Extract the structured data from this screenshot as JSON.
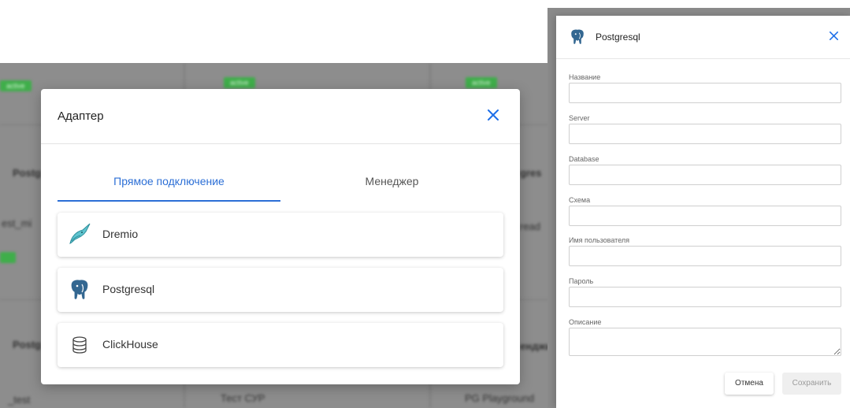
{
  "background": {
    "badges": [
      "active",
      "active",
      "active"
    ],
    "col1": {
      "name": "Postg",
      "sub": "est_mi",
      "name2": "Postg",
      "bottom": "_test"
    },
    "col2": {
      "bottom": "Тест СУР"
    },
    "col3": {
      "name": "gres",
      "sub": "read",
      "name2": "енджи",
      "bottom": "PG Playground"
    }
  },
  "modal": {
    "title": "Адаптер",
    "tabs": [
      {
        "label": "Прямое подключение",
        "active": true
      },
      {
        "label": "Менеджер",
        "active": false
      }
    ],
    "adapters": [
      {
        "label": "Dremio",
        "icon": "dremio-narwhal-icon"
      },
      {
        "label": "Postgresql",
        "icon": "postgresql-elephant-icon"
      },
      {
        "label": "ClickHouse",
        "icon": "database-icon"
      }
    ]
  },
  "panel": {
    "title": "Postgresql",
    "icon": "postgresql-elephant-icon",
    "fields": {
      "name": {
        "label": "Название",
        "value": ""
      },
      "server": {
        "label": "Server",
        "value": ""
      },
      "database": {
        "label": "Database",
        "value": ""
      },
      "schema": {
        "label": "Схема",
        "value": ""
      },
      "username": {
        "label": "Имя пользователя",
        "value": ""
      },
      "password": {
        "label": "Пароль",
        "value": ""
      },
      "description": {
        "label": "Описание",
        "value": ""
      }
    },
    "cancel_label": "Отмена",
    "save_label": "Сохранить"
  },
  "colors": {
    "accent": "#2c6fd6",
    "close": "#1e6fe8",
    "badge": "#3fae4a",
    "overlay": "#8d8d8d"
  }
}
